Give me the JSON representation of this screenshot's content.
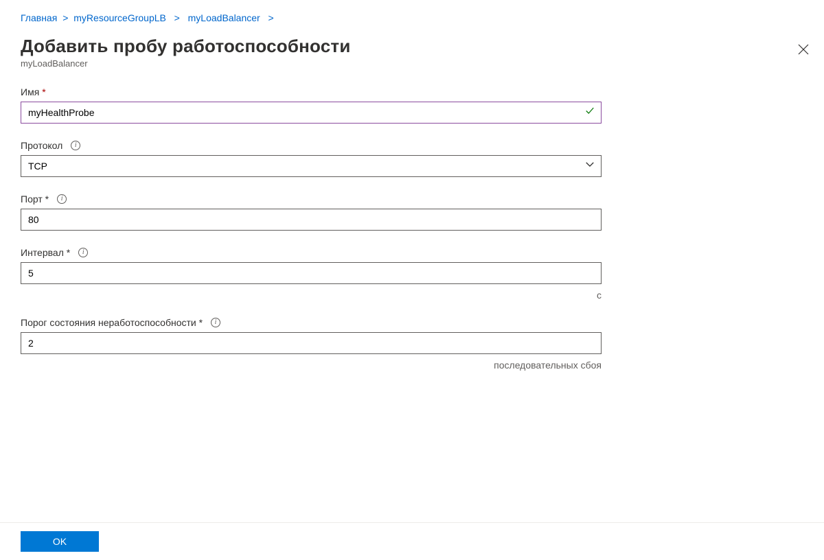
{
  "breadcrumb": {
    "items": [
      {
        "label": "Главная"
      },
      {
        "label": "myResourceGroupLB"
      },
      {
        "label": "myLoadBalancer"
      }
    ]
  },
  "page": {
    "title": "Добавить пробу работоспособности",
    "subtitle": "myLoadBalancer"
  },
  "form": {
    "name": {
      "label": "Имя",
      "value": "myHealthProbe"
    },
    "protocol": {
      "label": "Протокол",
      "value": "TCP"
    },
    "port": {
      "label": "Порт *",
      "value": "80"
    },
    "interval": {
      "label": "Интервал *",
      "value": "5",
      "suffix": "с"
    },
    "threshold": {
      "label": "Порог состояния неработоспособности *",
      "value": "2",
      "suffix": "последовательных сбоя"
    }
  },
  "footer": {
    "ok": "OK"
  }
}
